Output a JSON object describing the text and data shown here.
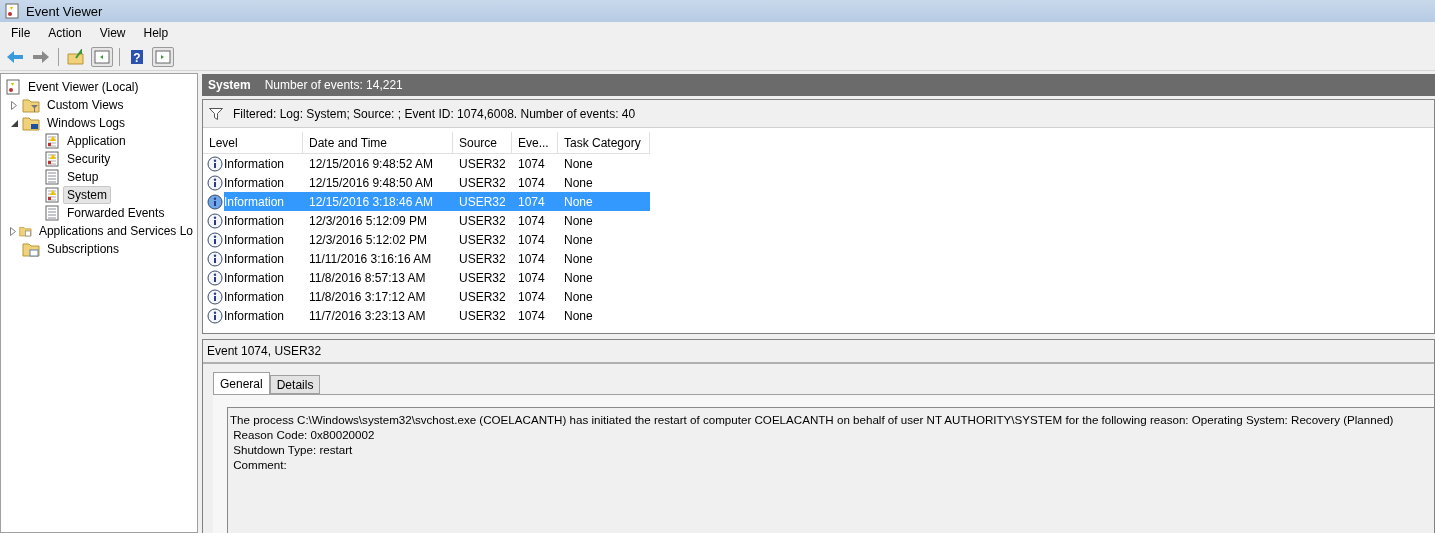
{
  "window": {
    "title": "Event Viewer"
  },
  "menu": [
    {
      "label": "File"
    },
    {
      "label": "Action"
    },
    {
      "label": "View"
    },
    {
      "label": "Help"
    }
  ],
  "toolbar": [
    {
      "kind": "back"
    },
    {
      "kind": "forward"
    },
    {
      "kind": "separator"
    },
    {
      "kind": "folder-up"
    },
    {
      "kind": "pane-left"
    },
    {
      "kind": "separator"
    },
    {
      "kind": "help",
      "label": "?"
    },
    {
      "kind": "pane-right"
    }
  ],
  "tree": [
    {
      "label": "Event Viewer (Local)",
      "kind": "root",
      "selected": false,
      "children": [
        {
          "label": "Custom Views",
          "kind": "filter-folder",
          "expanded": false,
          "selected": false
        },
        {
          "label": "Windows Logs",
          "kind": "computer-folder",
          "expanded": true,
          "selected": false,
          "children": [
            {
              "label": "Application",
              "kind": "log-warning",
              "selected": false
            },
            {
              "label": "Security",
              "kind": "log-warning",
              "selected": false
            },
            {
              "label": "Setup",
              "kind": "log",
              "selected": false
            },
            {
              "label": "System",
              "kind": "log-warning",
              "selected": true
            },
            {
              "label": "Forwarded Events",
              "kind": "log",
              "selected": false
            }
          ]
        },
        {
          "label": "Applications and Services Lo",
          "kind": "folder",
          "expanded": false,
          "selected": false
        },
        {
          "label": "Subscriptions",
          "kind": "subscription-folder",
          "selected": false
        }
      ]
    }
  ],
  "log_header": {
    "title": "System",
    "count": "Number of events: 14,221"
  },
  "filter": {
    "text": "Filtered: Log: System; Source: ; Event ID: 1074,6008. Number of events: 40"
  },
  "table": {
    "columns": [
      "Level",
      "Date and Time",
      "Source",
      "Eve...",
      "Task Category"
    ],
    "rows": [
      {
        "level": "Information",
        "date": "12/15/2016 9:48:52 AM",
        "source": "USER32",
        "event_id": "1074",
        "category": "None",
        "selected": false
      },
      {
        "level": "Information",
        "date": "12/15/2016 9:48:50 AM",
        "source": "USER32",
        "event_id": "1074",
        "category": "None",
        "selected": false
      },
      {
        "level": "Information",
        "date": "12/15/2016 3:18:46 AM",
        "source": "USER32",
        "event_id": "1074",
        "category": "None",
        "selected": true
      },
      {
        "level": "Information",
        "date": "12/3/2016 5:12:09 PM",
        "source": "USER32",
        "event_id": "1074",
        "category": "None",
        "selected": false
      },
      {
        "level": "Information",
        "date": "12/3/2016 5:12:02 PM",
        "source": "USER32",
        "event_id": "1074",
        "category": "None",
        "selected": false
      },
      {
        "level": "Information",
        "date": "11/11/2016 3:16:16 AM",
        "source": "USER32",
        "event_id": "1074",
        "category": "None",
        "selected": false
      },
      {
        "level": "Information",
        "date": "11/8/2016 8:57:13 AM",
        "source": "USER32",
        "event_id": "1074",
        "category": "None",
        "selected": false
      },
      {
        "level": "Information",
        "date": "11/8/2016 3:17:12 AM",
        "source": "USER32",
        "event_id": "1074",
        "category": "None",
        "selected": false
      },
      {
        "level": "Information",
        "date": "11/7/2016 3:23:13 AM",
        "source": "USER32",
        "event_id": "1074",
        "category": "None",
        "selected": false
      }
    ]
  },
  "detail": {
    "title": "Event 1074, USER32",
    "tabs": [
      {
        "label": "General",
        "selected": true
      },
      {
        "label": "Details",
        "selected": false
      }
    ],
    "lines": [
      "The process C:\\Windows\\system32\\svchost.exe (COELACANTH) has initiated the restart of computer COELACANTH on behalf of user NT AUTHORITY\\SYSTEM for the following reason: Operating System: Recovery (Planned)",
      " Reason Code: 0x80020002",
      " Shutdown Type: restart",
      " Comment:"
    ]
  }
}
